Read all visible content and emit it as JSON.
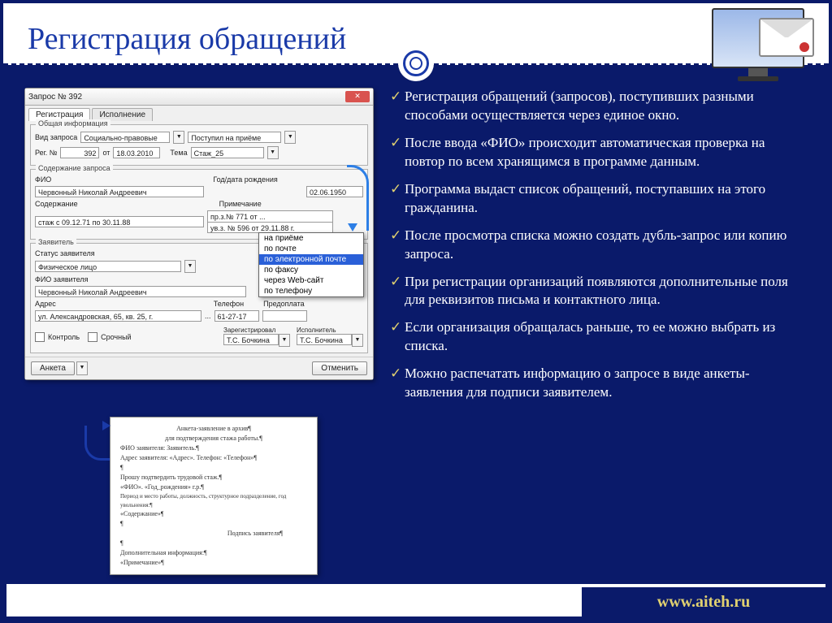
{
  "title": "Регистрация обращений",
  "footer_url": "www.aiteh.ru",
  "window": {
    "title": "Запрос № 392",
    "tabs": [
      "Регистрация",
      "Исполнение"
    ],
    "groups": {
      "general": "Общая информация",
      "content": "Содержание запроса",
      "applicant": "Заявитель"
    },
    "labels": {
      "type": "Вид запроса",
      "received": "Поступил на приёме",
      "regno": "Рег. №",
      "from": "от",
      "topic": "Тема",
      "fio": "ФИО",
      "birth": "Год/дата рождения",
      "content": "Содержание",
      "note": "Примечание",
      "status": "Статус заявителя",
      "fio_appl": "ФИО заявителя",
      "address": "Адрес",
      "phone": "Телефон",
      "prepay": "Предоплата",
      "control": "Контроль",
      "urgent": "Срочный",
      "registered": "Зарегистрировал",
      "executor": "Исполнитель"
    },
    "values": {
      "type": "Социально-правовые",
      "regno": "392",
      "date": "18.03.2010",
      "topic": "Стаж_25",
      "fio": "Червонный Николай Андреевич",
      "birth": "02.06.1950",
      "content": "стаж с 09.12.71 по 30.11.88",
      "note1": "пр.з.№ 771 от ...",
      "note2": "ув.з. № 596 от 29.11.88 г.",
      "status": "Физическое лицо",
      "fio_appl": "Червонный Николай Андреевич",
      "address": "ул. Александровская, 65, кв. 25, г.",
      "phone": "61-27-17",
      "registered": "Т.С. Бочкина",
      "executor": "Т.С. Бочкина"
    },
    "buttons": {
      "anketa": "Анкета",
      "cancel": "Отменить"
    }
  },
  "dropdown": {
    "items": [
      "на приёме",
      "по почте",
      "по электронной почте",
      "по факсу",
      "через Web-сайт",
      "по телефону"
    ],
    "selected": 2
  },
  "doc": {
    "t1": "Анкета-заявление в архив¶",
    "t2": "для подтверждения стажа работы.¶",
    "l1": "ФИО заявителя: Заявитель.¶",
    "l2": "Адрес заявителя: «Адрес». Телефон: «Телефон»¶",
    "l3": "Прошу подтвердить трудовой стаж.¶",
    "l4": "«ФИО». «Год_рождения» г.р.¶",
    "l5": "Период и место работы, должность, структурное подразделение, год увольнения:¶",
    "l6": "«Содержание»¶",
    "sign": "Подпись заявителя¶",
    "l7": "Дополнительная информация:¶",
    "l8": "«Примечание»¶"
  },
  "bullets": [
    "Регистрация обращений (запросов), поступивших разными способами осуществляется через единое  окно.",
    "После ввода «ФИО» происходит автоматическая проверка на повтор по всем хранящимся в программе данным.",
    "Программа выдаст список обращений, поступавших на этого гражданина.",
    "После просмотра списка можно создать дубль-запрос или копию запроса.",
    "При регистрации организаций появляются дополнительные поля для реквизитов письма и контактного лица.",
    "Если организация обращалась раньше, то ее можно выбрать из списка.",
    "Можно распечатать информацию о запросе в виде анкеты-заявления для подписи заявителем."
  ]
}
